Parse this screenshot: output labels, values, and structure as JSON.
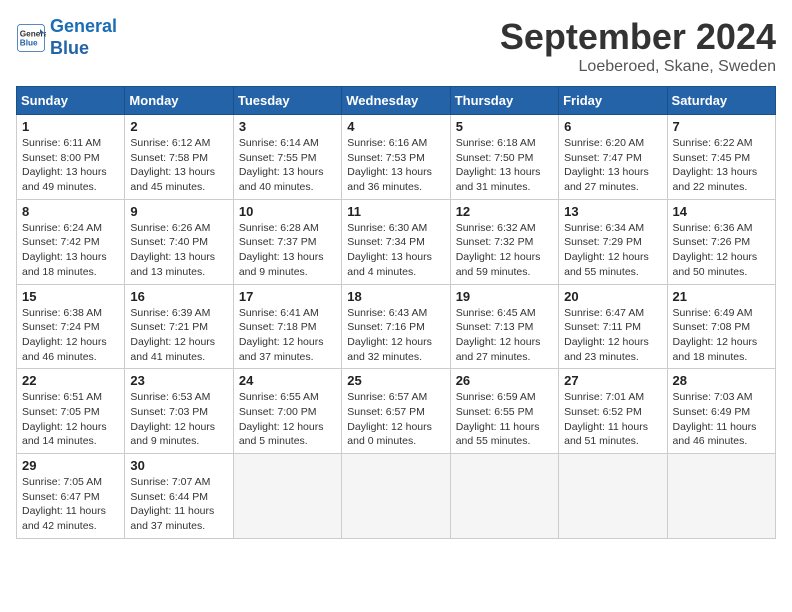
{
  "header": {
    "logo_line1": "General",
    "logo_line2": "Blue",
    "month": "September 2024",
    "location": "Loeberoed, Skane, Sweden"
  },
  "weekdays": [
    "Sunday",
    "Monday",
    "Tuesday",
    "Wednesday",
    "Thursday",
    "Friday",
    "Saturday"
  ],
  "weeks": [
    [
      {
        "day": 1,
        "info": "Sunrise: 6:11 AM\nSunset: 8:00 PM\nDaylight: 13 hours\nand 49 minutes."
      },
      {
        "day": 2,
        "info": "Sunrise: 6:12 AM\nSunset: 7:58 PM\nDaylight: 13 hours\nand 45 minutes."
      },
      {
        "day": 3,
        "info": "Sunrise: 6:14 AM\nSunset: 7:55 PM\nDaylight: 13 hours\nand 40 minutes."
      },
      {
        "day": 4,
        "info": "Sunrise: 6:16 AM\nSunset: 7:53 PM\nDaylight: 13 hours\nand 36 minutes."
      },
      {
        "day": 5,
        "info": "Sunrise: 6:18 AM\nSunset: 7:50 PM\nDaylight: 13 hours\nand 31 minutes."
      },
      {
        "day": 6,
        "info": "Sunrise: 6:20 AM\nSunset: 7:47 PM\nDaylight: 13 hours\nand 27 minutes."
      },
      {
        "day": 7,
        "info": "Sunrise: 6:22 AM\nSunset: 7:45 PM\nDaylight: 13 hours\nand 22 minutes."
      }
    ],
    [
      {
        "day": 8,
        "info": "Sunrise: 6:24 AM\nSunset: 7:42 PM\nDaylight: 13 hours\nand 18 minutes."
      },
      {
        "day": 9,
        "info": "Sunrise: 6:26 AM\nSunset: 7:40 PM\nDaylight: 13 hours\nand 13 minutes."
      },
      {
        "day": 10,
        "info": "Sunrise: 6:28 AM\nSunset: 7:37 PM\nDaylight: 13 hours\nand 9 minutes."
      },
      {
        "day": 11,
        "info": "Sunrise: 6:30 AM\nSunset: 7:34 PM\nDaylight: 13 hours\nand 4 minutes."
      },
      {
        "day": 12,
        "info": "Sunrise: 6:32 AM\nSunset: 7:32 PM\nDaylight: 12 hours\nand 59 minutes."
      },
      {
        "day": 13,
        "info": "Sunrise: 6:34 AM\nSunset: 7:29 PM\nDaylight: 12 hours\nand 55 minutes."
      },
      {
        "day": 14,
        "info": "Sunrise: 6:36 AM\nSunset: 7:26 PM\nDaylight: 12 hours\nand 50 minutes."
      }
    ],
    [
      {
        "day": 15,
        "info": "Sunrise: 6:38 AM\nSunset: 7:24 PM\nDaylight: 12 hours\nand 46 minutes."
      },
      {
        "day": 16,
        "info": "Sunrise: 6:39 AM\nSunset: 7:21 PM\nDaylight: 12 hours\nand 41 minutes."
      },
      {
        "day": 17,
        "info": "Sunrise: 6:41 AM\nSunset: 7:18 PM\nDaylight: 12 hours\nand 37 minutes."
      },
      {
        "day": 18,
        "info": "Sunrise: 6:43 AM\nSunset: 7:16 PM\nDaylight: 12 hours\nand 32 minutes."
      },
      {
        "day": 19,
        "info": "Sunrise: 6:45 AM\nSunset: 7:13 PM\nDaylight: 12 hours\nand 27 minutes."
      },
      {
        "day": 20,
        "info": "Sunrise: 6:47 AM\nSunset: 7:11 PM\nDaylight: 12 hours\nand 23 minutes."
      },
      {
        "day": 21,
        "info": "Sunrise: 6:49 AM\nSunset: 7:08 PM\nDaylight: 12 hours\nand 18 minutes."
      }
    ],
    [
      {
        "day": 22,
        "info": "Sunrise: 6:51 AM\nSunset: 7:05 PM\nDaylight: 12 hours\nand 14 minutes."
      },
      {
        "day": 23,
        "info": "Sunrise: 6:53 AM\nSunset: 7:03 PM\nDaylight: 12 hours\nand 9 minutes."
      },
      {
        "day": 24,
        "info": "Sunrise: 6:55 AM\nSunset: 7:00 PM\nDaylight: 12 hours\nand 5 minutes."
      },
      {
        "day": 25,
        "info": "Sunrise: 6:57 AM\nSunset: 6:57 PM\nDaylight: 12 hours\nand 0 minutes."
      },
      {
        "day": 26,
        "info": "Sunrise: 6:59 AM\nSunset: 6:55 PM\nDaylight: 11 hours\nand 55 minutes."
      },
      {
        "day": 27,
        "info": "Sunrise: 7:01 AM\nSunset: 6:52 PM\nDaylight: 11 hours\nand 51 minutes."
      },
      {
        "day": 28,
        "info": "Sunrise: 7:03 AM\nSunset: 6:49 PM\nDaylight: 11 hours\nand 46 minutes."
      }
    ],
    [
      {
        "day": 29,
        "info": "Sunrise: 7:05 AM\nSunset: 6:47 PM\nDaylight: 11 hours\nand 42 minutes."
      },
      {
        "day": 30,
        "info": "Sunrise: 7:07 AM\nSunset: 6:44 PM\nDaylight: 11 hours\nand 37 minutes."
      },
      null,
      null,
      null,
      null,
      null
    ]
  ]
}
